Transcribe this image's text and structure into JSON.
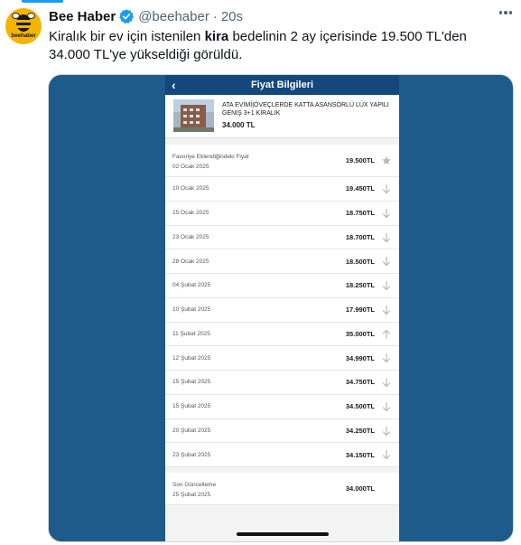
{
  "author": {
    "name": "Bee Haber",
    "handle": "@beehaber",
    "separator": "·",
    "time": "20s",
    "avatar_text": "beehaber"
  },
  "tweet": {
    "text_before": "Kiralık bir ev için istenilen ",
    "text_bold": "kira",
    "text_after": " bedelinin 2 ay içerisinde 19.500 TL'den 34.000 TL'ye yükseldiği görüldü."
  },
  "screenshot": {
    "nav_title": "Fiyat Bilgileri",
    "back_icon": "‹",
    "listing": {
      "title": "ATA EVİMİ|ÖVEÇLERDE KATTA ASANSÖRLÜ LÜX YAPILI GENİŞ 3+1 KİRALIK",
      "price": "34.000 TL"
    },
    "first_row": {
      "label": "Favoriye Eklendiğindeki Fiyat",
      "date": "02 Ocak 2025",
      "price": "19.500TL",
      "icon": "star-icon"
    },
    "rows": [
      {
        "date": "10 Ocak 2025",
        "price": "19.450TL",
        "icon": "arrow-down-icon"
      },
      {
        "date": "15 Ocak 2025",
        "price": "18.750TL",
        "icon": "arrow-down-icon"
      },
      {
        "date": "23 Ocak 2025",
        "price": "18.700TL",
        "icon": "arrow-down-icon"
      },
      {
        "date": "28 Ocak 2025",
        "price": "18.500TL",
        "icon": "arrow-down-icon"
      },
      {
        "date": "04 Şubat 2025",
        "price": "18.250TL",
        "icon": "arrow-down-icon"
      },
      {
        "date": "10 Şubat 2025",
        "price": "17.990TL",
        "icon": "arrow-down-icon"
      },
      {
        "date": "11 Şubat 2025",
        "price": "35.000TL",
        "icon": "arrow-up-icon"
      },
      {
        "date": "12 Şubat 2025",
        "price": "34.990TL",
        "icon": "arrow-down-icon"
      },
      {
        "date": "15 Şubat 2025",
        "price": "34.750TL",
        "icon": "arrow-down-icon"
      },
      {
        "date": "15 Şubat 2025",
        "price": "34.500TL",
        "icon": "arrow-down-icon"
      },
      {
        "date": "20 Şubat 2025",
        "price": "34.250TL",
        "icon": "arrow-down-icon"
      },
      {
        "date": "23 Şubat 2025",
        "price": "34.150TL",
        "icon": "arrow-down-icon"
      }
    ],
    "last_row": {
      "label": "Son Güncelleme",
      "date": "25 Şubat 2025",
      "price": "34.000TL"
    }
  },
  "colors": {
    "accent": "#1d9bf0",
    "media_background": "#1e5a8a",
    "app_nav": "#14477c",
    "avatar": "#f5b400"
  }
}
